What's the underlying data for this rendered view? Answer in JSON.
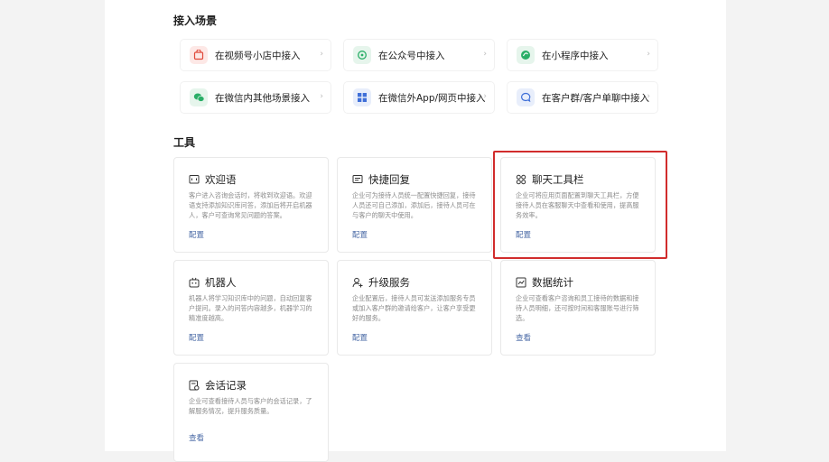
{
  "scenes": {
    "title": "接入场景",
    "items": [
      {
        "label": "在视频号小店中接入",
        "icon": "shop-icon",
        "color": "#fde8e6"
      },
      {
        "label": "在公众号中接入",
        "icon": "official-account-icon",
        "color": "#e6f5ec"
      },
      {
        "label": "在小程序中接入",
        "icon": "mini-program-icon",
        "color": "#e6f5ec"
      },
      {
        "label": "在微信内其他场景接入",
        "icon": "wechat-icon",
        "color": "#e6f5ec"
      },
      {
        "label": "在微信外App/网页中接入",
        "icon": "grid-icon",
        "color": "#e8eefb"
      },
      {
        "label": "在客户群/客户单聊中接入",
        "icon": "chat-bubble-icon",
        "color": "#e8eefb"
      }
    ]
  },
  "tools": {
    "title": "工具",
    "items": [
      {
        "title": "欢迎语",
        "icon": "message-icon",
        "desc": "客户进入咨询会话时，将收到欢迎语。欢迎语支持添加知识库问答，添加后将开启机器人，客户可查询常见问题的答案。",
        "link": "配置"
      },
      {
        "title": "快捷回复",
        "icon": "quick-reply-icon",
        "desc": "企业可为接待人员统一配置快捷回复，接待人员还可自己添加，添加后，接待人员可在与客户的聊天中使用。",
        "link": "配置"
      },
      {
        "title": "聊天工具栏",
        "icon": "toolbar-icon",
        "desc": "企业可将应用页面配置到聊天工具栏，方便接待人员在客服聊天中查看和使用，提高服务效率。",
        "link": "配置"
      },
      {
        "title": "机器人",
        "icon": "robot-icon",
        "desc": "机器人将学习知识库中的问题，自动回复客户提问。录入的问答内容越多，机器学习的精准度越高。",
        "link": "配置"
      },
      {
        "title": "升级服务",
        "icon": "upgrade-service-icon",
        "desc": "企业配置后，接待人员可发送添加服务专员或加入客户群的邀请给客户，让客户享受更好的服务。",
        "link": "配置"
      },
      {
        "title": "数据统计",
        "icon": "statistics-icon",
        "desc": "企业可查看客户咨询和员工接待的数据和接待人员明细，还可按时间和客服账号进行筛选。",
        "link": "查看"
      },
      {
        "title": "会话记录",
        "icon": "chat-record-icon",
        "desc": "企业可查看接待人员与客户的会话记录，了解服务情况，提升服务质量。",
        "link": "查看"
      }
    ]
  }
}
